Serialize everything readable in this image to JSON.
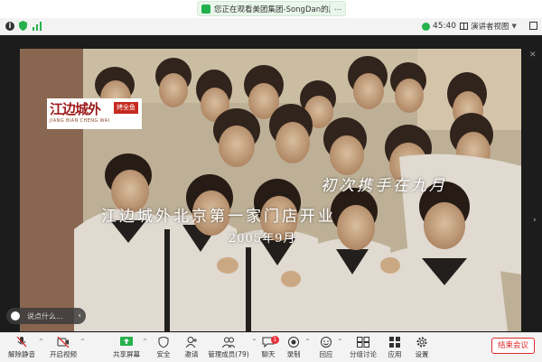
{
  "banner": {
    "text": "您正在观看美团集团-SongDan的屏幕",
    "more": "..."
  },
  "topbar": {
    "elapsed": "45:40",
    "view_label": "演讲者视图"
  },
  "video": {
    "logo_text": "江边城外",
    "logo_seal": "烤全鱼",
    "logo_pinyin": "JIANG BIAN CHENG WAI",
    "slogan": "初次携手在九月",
    "headline": "江边城外北京第一家门店开业",
    "date": "2005年9月",
    "chat_placeholder": "说点什么..."
  },
  "toolbar": {
    "items": [
      {
        "label": "解除静音",
        "icon": "mic-muted-icon"
      },
      {
        "label": "开启视频",
        "icon": "video-off-icon"
      },
      {
        "label": "共享屏幕",
        "icon": "share-screen-icon"
      },
      {
        "label": "安全",
        "icon": "shield-icon"
      },
      {
        "label": "邀请",
        "icon": "invite-icon"
      },
      {
        "label": "管理成员(79)",
        "icon": "participants-icon"
      },
      {
        "label": "聊天",
        "icon": "chat-icon",
        "badge": "1"
      },
      {
        "label": "录制",
        "icon": "record-icon"
      },
      {
        "label": "回应",
        "icon": "reaction-icon"
      },
      {
        "label": "分组讨论",
        "icon": "breakout-icon"
      },
      {
        "label": "应用",
        "icon": "apps-icon"
      },
      {
        "label": "设置",
        "icon": "settings-icon"
      }
    ],
    "end_label": "结束会议"
  },
  "colors": {
    "accent_green": "#22b14c",
    "end_red": "#e02828",
    "badge_red": "#e8313b"
  }
}
